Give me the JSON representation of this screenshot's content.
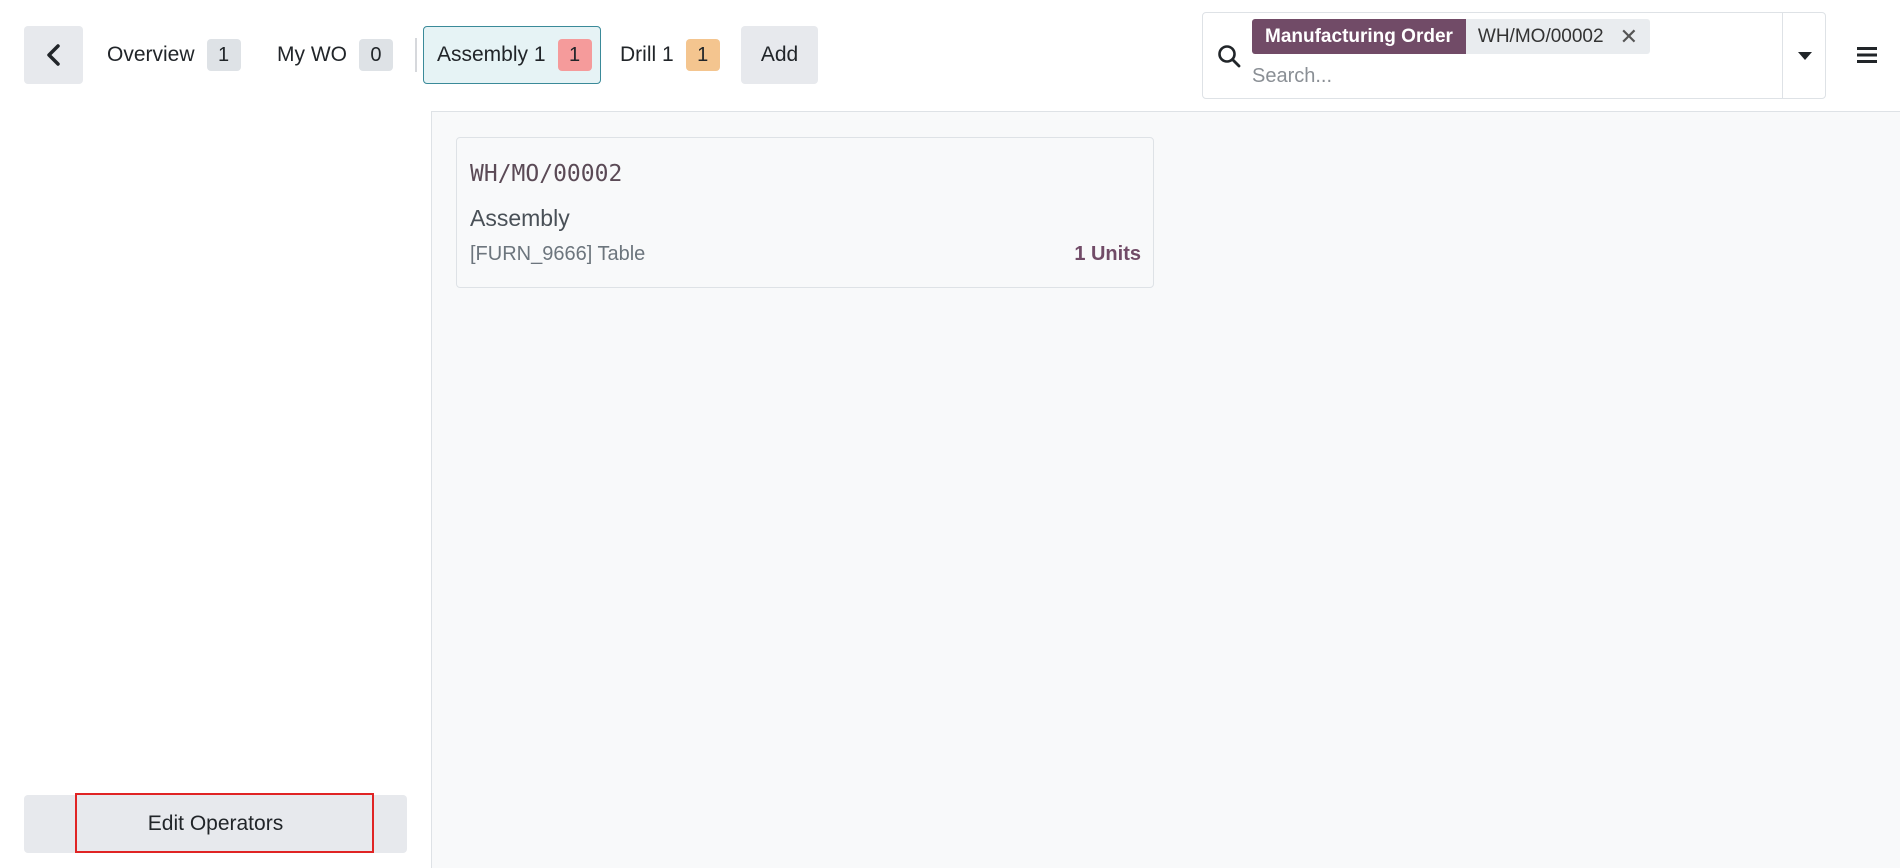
{
  "header": {
    "tabs": [
      {
        "label": "Overview",
        "count": "1"
      },
      {
        "label": "My WO",
        "count": "0"
      },
      {
        "label": "Assembly 1",
        "count": "1"
      },
      {
        "label": "Drill 1",
        "count": "1"
      }
    ],
    "add_label": "Add"
  },
  "search": {
    "facet_label": "Manufacturing Order",
    "facet_value": "WH/MO/00002",
    "placeholder": "Search..."
  },
  "sidebar": {
    "edit_operators_label": "Edit Operators"
  },
  "workorder": {
    "reference": "WH/MO/00002",
    "operation": "Assembly",
    "product": "[FURN_9666] Table",
    "quantity": "1 Units"
  },
  "colors": {
    "brand": "#714b67",
    "active_tab_border": "#3a8a99",
    "assembly_badge": "#f59b9b",
    "drill_badge": "#f4c58f",
    "highlight_box": "#e02424"
  },
  "icons": {
    "back": "chevron-left-icon",
    "search": "search-icon",
    "remove_facet": "close-icon",
    "toggle": "caret-down-icon",
    "menu": "hamburger-icon"
  }
}
